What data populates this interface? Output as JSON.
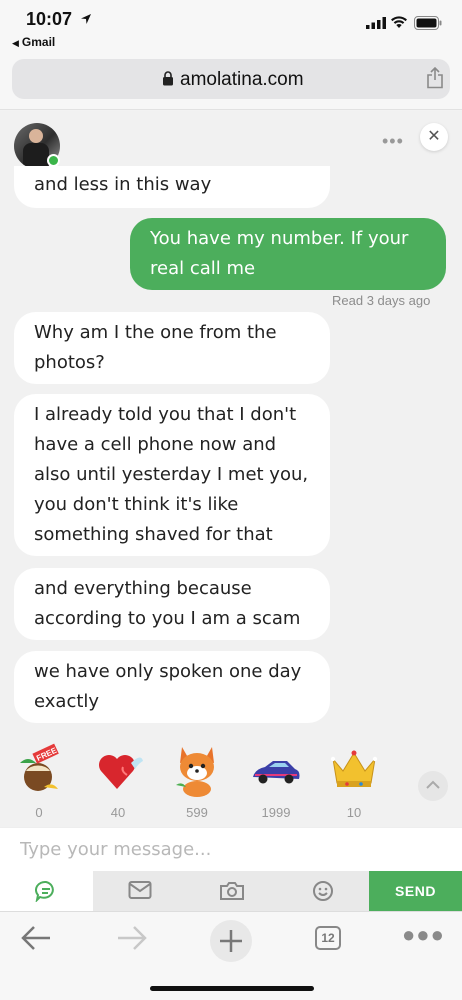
{
  "status_bar": {
    "time": "10:07",
    "back_app": "Gmail"
  },
  "browser": {
    "url": "amolatina.com",
    "tab_count": "12"
  },
  "chat": {
    "menu_glyph": "•••",
    "close_glyph": "✕",
    "messages": [
      {
        "from": "them",
        "text": "and less in this way"
      },
      {
        "from": "me",
        "text": "You have my number. If your real call me"
      },
      {
        "from": "them",
        "text": "Why am I the one from the photos?"
      },
      {
        "from": "them",
        "text": "I already told you that I don't have a cell phone now and also until yesterday I met you, you don't think it's like something shaved for that"
      },
      {
        "from": "them",
        "text": "and everything because according to you I am a scam"
      },
      {
        "from": "them",
        "text": "we have only spoken one day exactly"
      }
    ],
    "read_receipt": "Read 3 days ago"
  },
  "gifts": [
    {
      "icon": "cocktail-free-icon",
      "price": "0",
      "badge": "FREE"
    },
    {
      "icon": "winged-heart-icon",
      "price": "40"
    },
    {
      "icon": "fox-icon",
      "price": "599"
    },
    {
      "icon": "sports-car-icon",
      "price": "1999"
    },
    {
      "icon": "crown-icon",
      "price": "10"
    }
  ],
  "composer": {
    "placeholder": "Type your message...",
    "send_label": "SEND"
  },
  "colors": {
    "accent_green": "#4cae5c",
    "online": "#3bb54a"
  }
}
